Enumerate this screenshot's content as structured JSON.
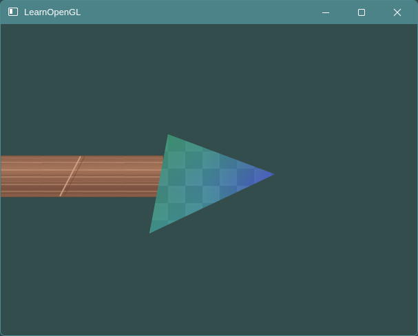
{
  "window": {
    "title": "LearnOpenGL",
    "icon": "window-app-icon",
    "controls": {
      "minimize": "minimize-icon",
      "maximize": "maximize-icon",
      "close": "close-icon"
    },
    "titlebar_color": "#4b8389",
    "clear_color": "#334d4d"
  },
  "scene": {
    "objects": [
      {
        "name": "wooden-bar",
        "texture": "wood-container",
        "color": "#9a6a4e"
      },
      {
        "name": "checker-triangle",
        "texture": "checker-tile",
        "vertex_colors": [
          "#3d8a5e",
          "#3f8ea8",
          "#4b4fc4"
        ]
      }
    ]
  }
}
